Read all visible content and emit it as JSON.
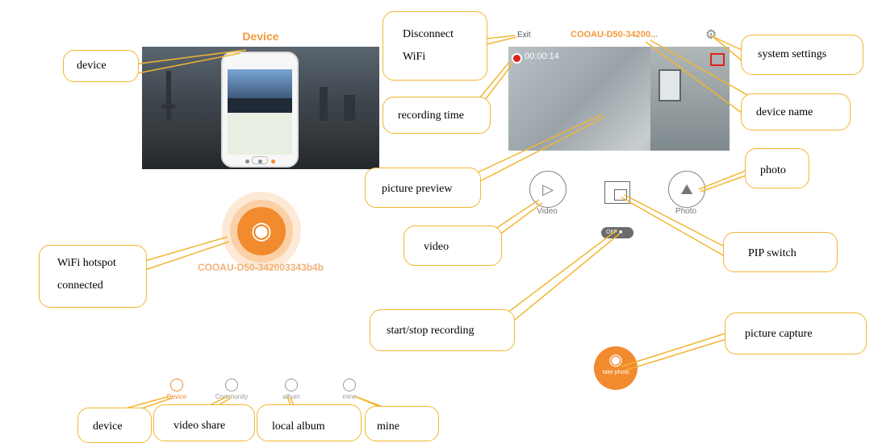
{
  "left_screen": {
    "title": "Device",
    "hotspot_name": "COOAU-D50-342003343b4b",
    "tabs": [
      {
        "label": "Device",
        "icon": "device-icon",
        "active": true
      },
      {
        "label": "Community",
        "icon": "community-icon",
        "active": false
      },
      {
        "label": "album",
        "icon": "album-icon",
        "active": false
      },
      {
        "label": "mine",
        "icon": "user-icon",
        "active": false
      }
    ]
  },
  "right_screen": {
    "exit_label": "Exit",
    "device_name": "COOAU-D50-34200...",
    "recording_time": "00:00:14",
    "video_label": "Video",
    "photo_label": "Photo",
    "rec_toggle_label": "OFF",
    "take_photo_label": "take photo"
  },
  "callouts": {
    "device_top": "device",
    "disconnect_wifi": "Disconnect\nWiFi",
    "system_settings": "system settings",
    "recording_time": "recording time",
    "device_name": "device name",
    "picture_preview": "picture preview",
    "photo": "photo",
    "video": "video",
    "pip_switch": "PIP switch",
    "wifi_hotspot": "WiFi  hotspot\nconnected",
    "start_stop": "start/stop recording",
    "picture_capture": "picture capture",
    "device_bottom": "device",
    "video_share": "video share",
    "local_album": "local album",
    "mine": "mine"
  },
  "colors": {
    "accent": "#f28a2e",
    "callout_border": "#f2b632"
  }
}
